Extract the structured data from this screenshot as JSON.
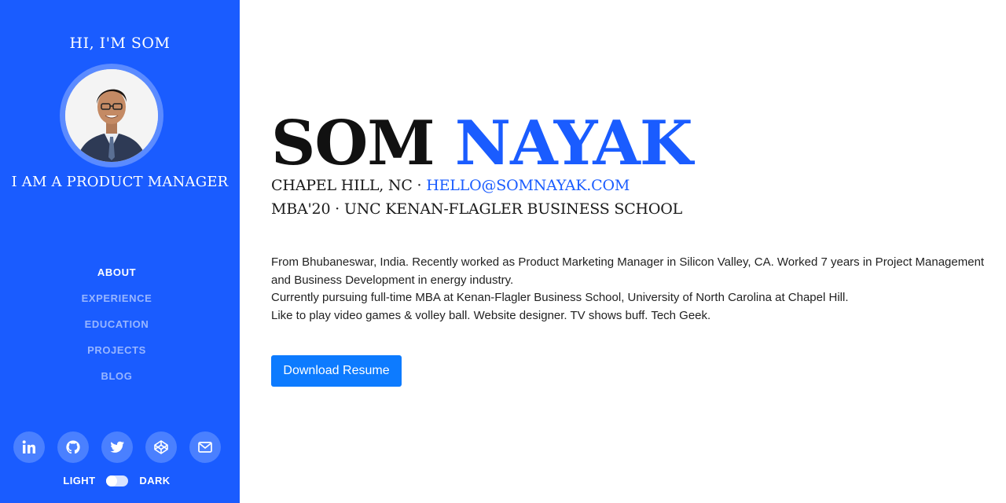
{
  "sidebar": {
    "greeting": "HI, I'M SOM",
    "role": "I AM A PRODUCT MANAGER",
    "nav": [
      {
        "label": "ABOUT",
        "active": true
      },
      {
        "label": "EXPERIENCE",
        "active": false
      },
      {
        "label": "EDUCATION",
        "active": false
      },
      {
        "label": "PROJECTS",
        "active": false
      },
      {
        "label": "BLOG",
        "active": false
      }
    ],
    "socials": [
      "linkedin-icon",
      "github-icon",
      "twitter-icon",
      "codepen-icon",
      "email-icon"
    ],
    "theme": {
      "light_label": "LIGHT",
      "dark_label": "DARK",
      "mode": "light"
    },
    "background_color": "#1a5cff"
  },
  "main": {
    "first_name": "SOM",
    "last_name": "NAYAK",
    "location": "CHAPEL HILL, NC",
    "separator": " · ",
    "email": "HELLO@SOMNAYAK.COM",
    "degree": "MBA'20",
    "school": "UNC KENAN-FLAGLER BUSINESS SCHOOL",
    "bio": [
      "From Bhubaneswar, India. Recently worked as Product Marketing Manager in Silicon Valley, CA. Worked 7 years in Project Management and Business Development in energy industry.",
      "Currently pursuing full-time MBA at Kenan-Flagler Business School, University of North Carolina at Chapel Hill.",
      "Like to play video games & volley ball. Website designer. TV shows buff. Tech Geek."
    ],
    "resume_button": "Download Resume",
    "accent_color": "#1a5cff",
    "button_color": "#0d7bff"
  }
}
